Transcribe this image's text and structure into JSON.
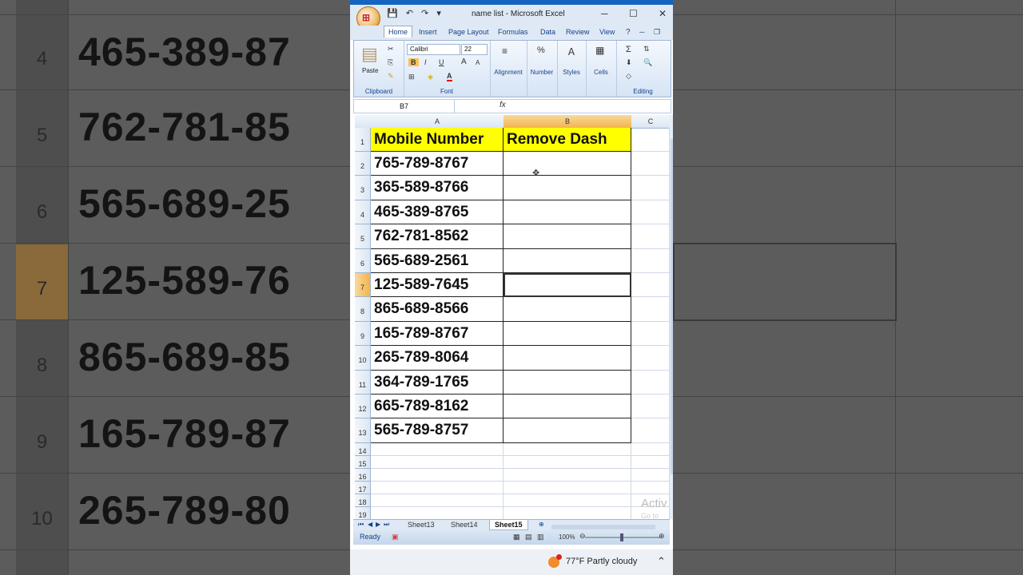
{
  "window": {
    "title": "name list - Microsoft Excel",
    "minimize": "─",
    "maximize": "☐",
    "close": "✕"
  },
  "ribbon_tabs": [
    "Home",
    "Insert",
    "Page Layout",
    "Formulas",
    "Data",
    "Review",
    "View"
  ],
  "ribbon": {
    "clipboard_label": "Clipboard",
    "paste_label": "Paste",
    "font_label": "Font",
    "font_name": "Calibri",
    "font_size": "22",
    "bold": "B",
    "italic": "I",
    "underline": "U",
    "grow_font": "A",
    "shrink_font": "A",
    "font_color": "A",
    "alignment_label": "Alignment",
    "number_label": "Number",
    "number_symbol": "%",
    "styles_label": "Styles",
    "cells_label": "Cells",
    "editing_label": "Editing",
    "sum_symbol": "Σ"
  },
  "formula_bar": {
    "name_box": "B7",
    "fx": "fx",
    "formula": ""
  },
  "columns": [
    {
      "label": "A",
      "selected": false
    },
    {
      "label": "B",
      "selected": true
    },
    {
      "label": "C",
      "selected": false
    }
  ],
  "sheet": {
    "headers": [
      "Mobile Number",
      "Remove Dash"
    ],
    "rows": [
      {
        "num": "2",
        "a": "765-789-8767",
        "b": ""
      },
      {
        "num": "3",
        "a": "365-589-8766",
        "b": ""
      },
      {
        "num": "4",
        "a": "465-389-8765",
        "b": ""
      },
      {
        "num": "5",
        "a": "762-781-8562",
        "b": ""
      },
      {
        "num": "6",
        "a": "565-689-2561",
        "b": ""
      },
      {
        "num": "7",
        "a": "125-589-7645",
        "b": ""
      },
      {
        "num": "8",
        "a": "865-689-8566",
        "b": ""
      },
      {
        "num": "9",
        "a": "165-789-8767",
        "b": ""
      },
      {
        "num": "10",
        "a": "265-789-8064",
        "b": ""
      },
      {
        "num": "11",
        "a": "364-789-1765",
        "b": ""
      },
      {
        "num": "12",
        "a": "665-789-8162",
        "b": ""
      },
      {
        "num": "13",
        "a": "565-789-8757",
        "b": ""
      }
    ],
    "empty_rows": [
      "14",
      "15",
      "16",
      "17",
      "18",
      "19"
    ],
    "active_cell": "B7",
    "header_fill": "#ffff00"
  },
  "watermark": {
    "line1": "Activ",
    "line2": "Go to"
  },
  "sheet_tabs": [
    {
      "label": "Sheet13",
      "active": false
    },
    {
      "label": "Sheet14",
      "active": false
    },
    {
      "label": "Sheet15",
      "active": true
    }
  ],
  "status": {
    "ready": "Ready",
    "zoom": "100%"
  },
  "taskbar": {
    "weather": "77°F  Partly cloudy",
    "badge": "1"
  },
  "background_left": [
    {
      "num": "4",
      "val": "465-389-87"
    },
    {
      "num": "5",
      "val": "762-781-85"
    },
    {
      "num": "6",
      "val": "565-689-25"
    },
    {
      "num": "7",
      "val": "125-589-76"
    },
    {
      "num": "8",
      "val": "865-689-85"
    },
    {
      "num": "9",
      "val": "165-789-87"
    },
    {
      "num": "10",
      "val": "265-789-80"
    }
  ]
}
